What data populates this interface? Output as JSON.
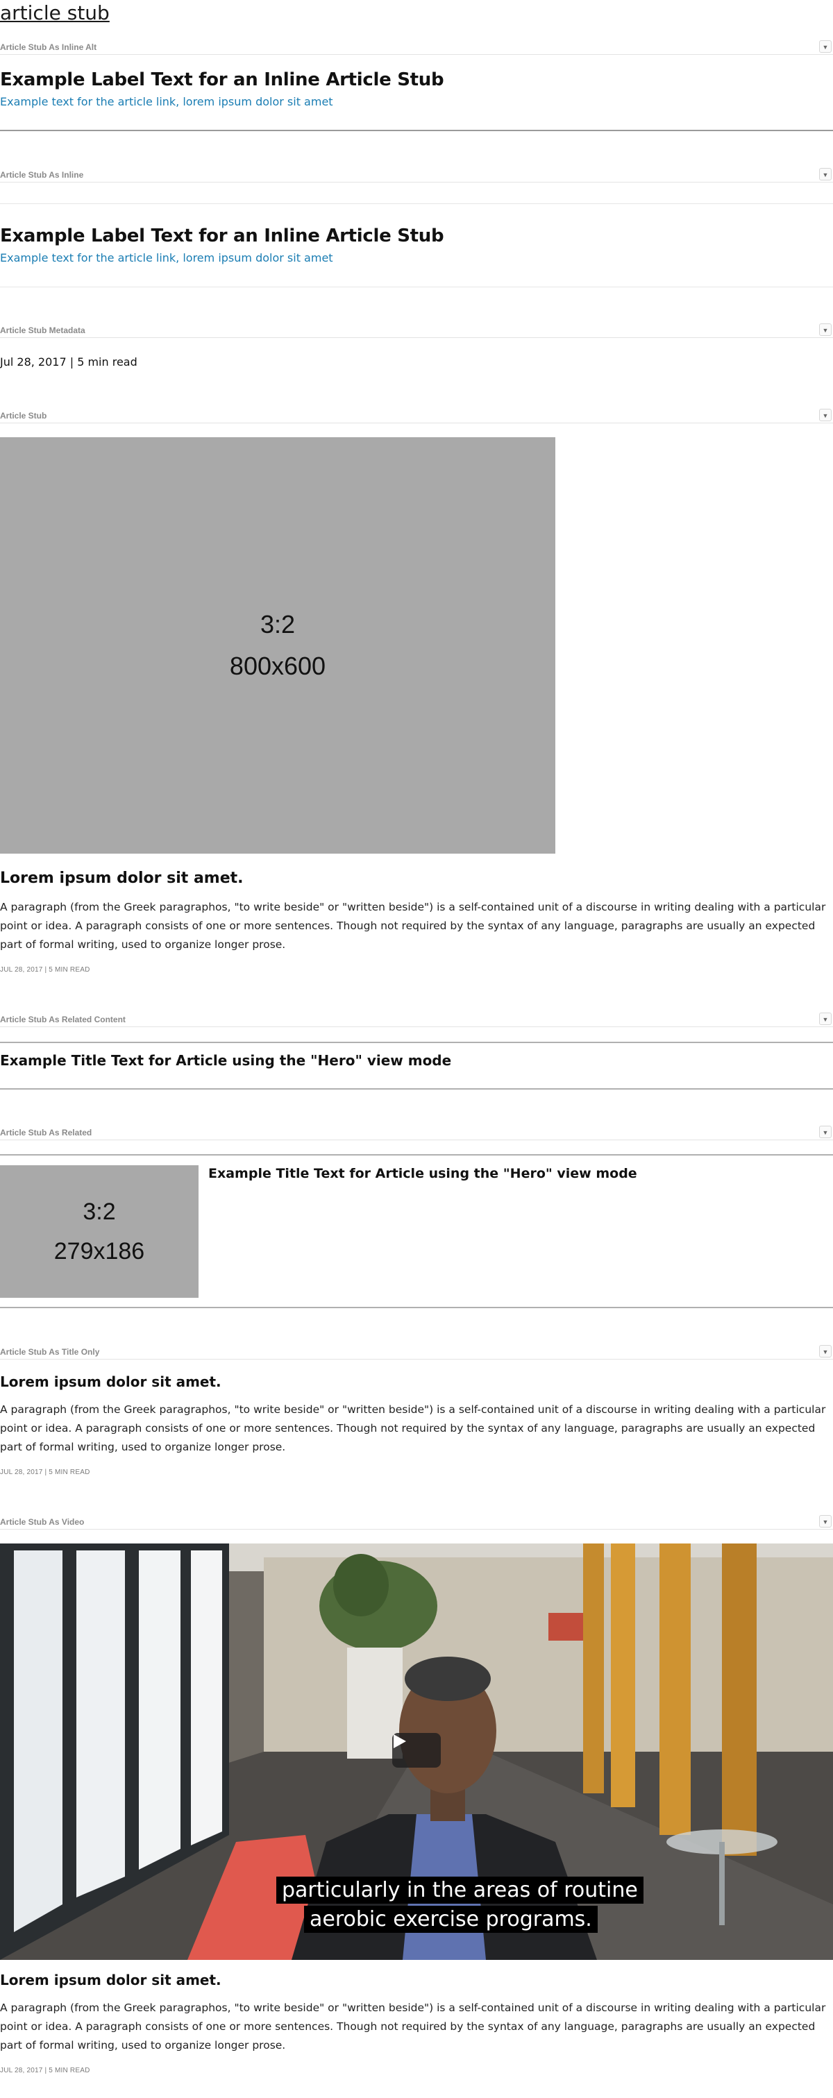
{
  "page": {
    "title": "article stub"
  },
  "sections": {
    "inline_alt": {
      "label": "Article Stub As Inline Alt",
      "title": "Example Label Text for an Inline Article Stub",
      "link": "Example text for the article link, lorem ipsum dolor sit amet"
    },
    "inline": {
      "label": "Article Stub As Inline",
      "title": "Example Label Text for an Inline Article Stub",
      "link": "Example text for the article link, lorem ipsum dolor sit amet"
    },
    "metadata": {
      "label": "Article Stub Metadata",
      "text": "Jul 28, 2017 | 5 min read"
    },
    "stub": {
      "label": "Article Stub",
      "image_ratio": "3:2",
      "image_dims": "800x600",
      "heading": "Lorem ipsum dolor sit amet.",
      "body": "A paragraph (from the Greek paragraphos, \"to write beside\" or \"written beside\") is a self-contained unit of a discourse in writing dealing with a particular point or idea. A paragraph consists of one or more sentences. Though not required by the syntax of any language, paragraphs are usually an expected part of formal writing, used to organize longer prose.",
      "meta": "JUL 28, 2017 | 5 MIN READ"
    },
    "related_content": {
      "label": "Article Stub As Related Content",
      "title": "Example Title Text for Article using the \"Hero\" view mode"
    },
    "related": {
      "label": "Article Stub As Related",
      "image_ratio": "3:2",
      "image_dims": "279x186",
      "title": "Example Title Text for Article using the \"Hero\" view mode"
    },
    "title_only": {
      "label": "Article Stub As Title Only",
      "heading": "Lorem ipsum dolor sit amet.",
      "body": "A paragraph (from the Greek paragraphos, \"to write beside\" or \"written beside\") is a self-contained unit of a discourse in writing dealing with a particular point or idea. A paragraph consists of one or more sentences. Though not required by the syntax of any language, paragraphs are usually an expected part of formal writing, used to organize longer prose.",
      "meta": "JUL 28, 2017 | 5 MIN READ"
    },
    "video": {
      "label": "Article Stub As Video",
      "caption_line1": "particularly in the areas of routine",
      "caption_line2": "aerobic exercise programs.",
      "heading": "Lorem ipsum dolor sit amet.",
      "body": "A paragraph (from the Greek paragraphos, \"to write beside\" or \"written beside\") is a self-contained unit of a discourse in writing dealing with a particular point or idea. A paragraph consists of one or more sentences. Though not required by the syntax of any language, paragraphs are usually an expected part of formal writing, used to organize longer prose.",
      "meta": "JUL 28, 2017 | 5 MIN READ"
    }
  },
  "icons": {
    "toggle": "chevron-down-icon",
    "play": "play-icon"
  },
  "colors": {
    "link": "#1a7db3",
    "placeholder": "#a9a9a9",
    "divider": "#e3e3e3"
  }
}
